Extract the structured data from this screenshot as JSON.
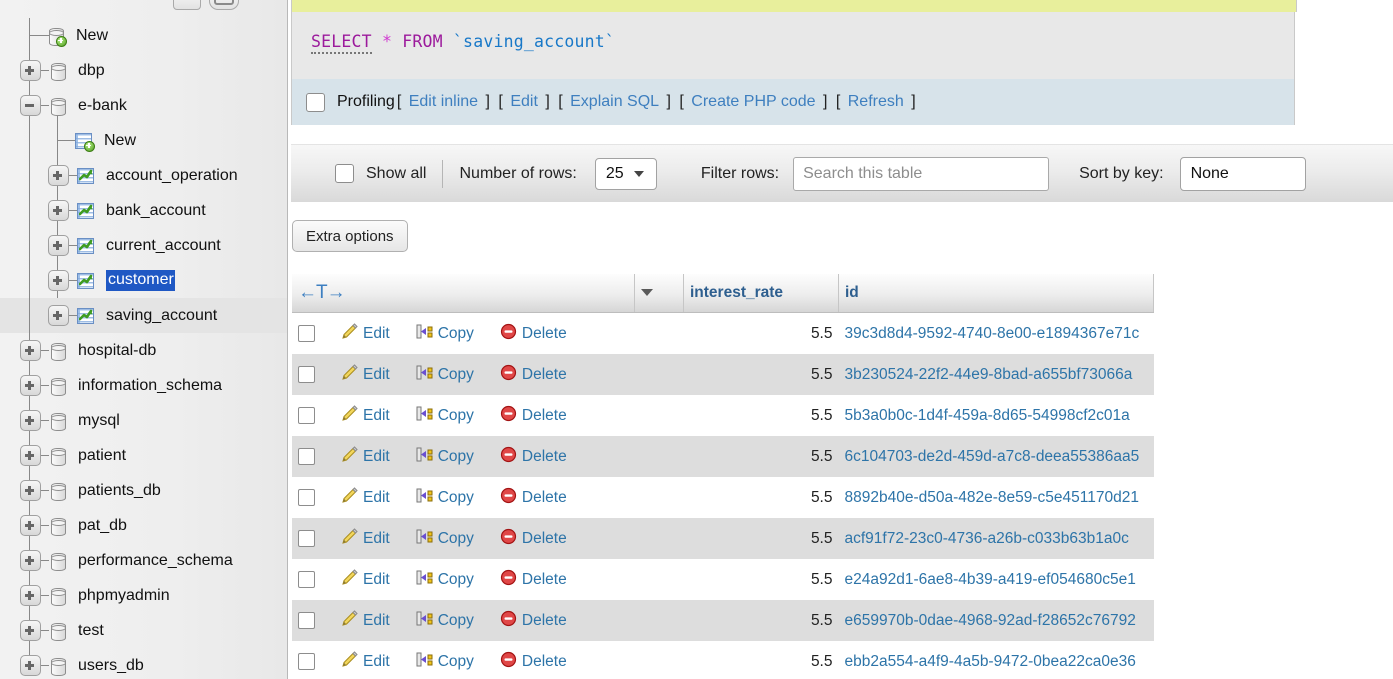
{
  "sidebar": {
    "topbar": {
      "collapse_icon": "minus-icon",
      "toggle_icon": "pill-toggle-icon"
    },
    "tree": [
      {
        "label": "New",
        "type": "db-new",
        "toggle": "none",
        "depth": 1
      },
      {
        "label": "dbp",
        "type": "db",
        "toggle": "plus",
        "depth": 1
      },
      {
        "label": "e-bank",
        "type": "db",
        "toggle": "minus",
        "depth": 1
      },
      {
        "label": "New",
        "type": "table-new",
        "toggle": "none",
        "depth": 2
      },
      {
        "label": "account_operation",
        "type": "table",
        "toggle": "plus",
        "depth": 2
      },
      {
        "label": "bank_account",
        "type": "table",
        "toggle": "plus",
        "depth": 2
      },
      {
        "label": "current_account",
        "type": "table",
        "toggle": "plus",
        "depth": 2
      },
      {
        "label": "customer",
        "type": "table",
        "toggle": "plus",
        "depth": 2,
        "selected": true
      },
      {
        "label": "saving_account",
        "type": "table",
        "toggle": "plus",
        "depth": 2,
        "hover": true
      },
      {
        "label": "hospital-db",
        "type": "db",
        "toggle": "plus",
        "depth": 1
      },
      {
        "label": "information_schema",
        "type": "db",
        "toggle": "plus",
        "depth": 1
      },
      {
        "label": "mysql",
        "type": "db",
        "toggle": "plus",
        "depth": 1
      },
      {
        "label": "patient",
        "type": "db",
        "toggle": "plus",
        "depth": 1
      },
      {
        "label": "patients_db",
        "type": "db",
        "toggle": "plus",
        "depth": 1
      },
      {
        "label": "pat_db",
        "type": "db",
        "toggle": "plus",
        "depth": 1
      },
      {
        "label": "performance_schema",
        "type": "db",
        "toggle": "plus",
        "depth": 1
      },
      {
        "label": "phpmyadmin",
        "type": "db",
        "toggle": "plus",
        "depth": 1
      },
      {
        "label": "test",
        "type": "db",
        "toggle": "plus",
        "depth": 1
      },
      {
        "label": "users_db",
        "type": "db",
        "toggle": "plus",
        "depth": 1
      }
    ]
  },
  "sql": {
    "keyword_select": "SELECT",
    "star": "*",
    "keyword_from": "FROM",
    "table_ref": "`saving_account`",
    "full_query": "SELECT * FROM `saving_account`"
  },
  "profiling": {
    "label": "Profiling",
    "links": [
      "Edit inline",
      "Edit",
      "Explain SQL",
      "Create PHP code",
      "Refresh"
    ],
    "bracket_open": "[",
    "bracket_close": "]"
  },
  "options": {
    "show_all_label": "Show all",
    "number_of_rows_label": "Number of rows:",
    "number_of_rows_value": "25",
    "filter_rows_label": "Filter rows:",
    "filter_placeholder": "Search this table",
    "sort_by_key_label": "Sort by key:",
    "sort_by_key_value": "None",
    "extra_options_label": "Extra options"
  },
  "table": {
    "headers": {
      "nav": "←T→",
      "interest_rate": "interest_rate",
      "id": "id"
    },
    "actions": {
      "edit": "Edit",
      "copy": "Copy",
      "delete": "Delete"
    },
    "rows": [
      {
        "interest_rate": "5.5",
        "id": "39c3d8d4-9592-4740-8e00-e1894367e71c"
      },
      {
        "interest_rate": "5.5",
        "id": "3b230524-22f2-44e9-8bad-a655bf73066a"
      },
      {
        "interest_rate": "5.5",
        "id": "5b3a0b0c-1d4f-459a-8d65-54998cf2c01a"
      },
      {
        "interest_rate": "5.5",
        "id": "6c104703-de2d-459d-a7c8-deea55386aa5"
      },
      {
        "interest_rate": "5.5",
        "id": "8892b40e-d50a-482e-8e59-c5e451170d21"
      },
      {
        "interest_rate": "5.5",
        "id": "acf91f72-23c0-4736-a26b-c033b63b1a0c"
      },
      {
        "interest_rate": "5.5",
        "id": "e24a92d1-6ae8-4b39-a419-ef054680c5e1"
      },
      {
        "interest_rate": "5.5",
        "id": "e659970b-0dae-4968-92ad-f28652c76792"
      },
      {
        "interest_rate": "5.5",
        "id": "ebb2a554-a4f9-4a5b-9472-0bea22ca0e36"
      }
    ]
  },
  "colors": {
    "sql_keyword": "#9c1a9c",
    "sql_identifier": "#1878c8",
    "link_blue": "#2d74a8",
    "header_blue": "#2e5f8f",
    "selection_blue": "#1f58c4",
    "yellow_strip": "#e8ef9c",
    "profiling_bar": "#d7e3ea",
    "row_stripe": "#dddddd"
  }
}
